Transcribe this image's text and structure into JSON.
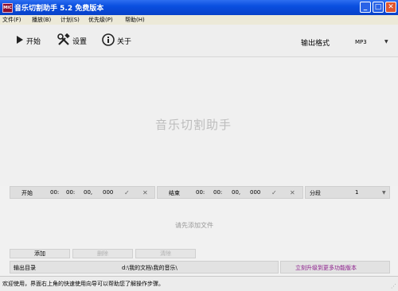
{
  "window": {
    "title": "音乐切割助手 5.2 免费版本",
    "icon_text": "MIC"
  },
  "menu": [
    "文件(F)",
    "播放(B)",
    "计划(S)",
    "优先级(P)",
    "帮助(H)"
  ],
  "toolbar": {
    "start": "开始",
    "settings": "设置",
    "about": "关于",
    "format_label": "输出格式",
    "format_value": "MP3"
  },
  "main": {
    "watermark": "音乐切割助手",
    "empty_hint": "请先添加文件"
  },
  "time": {
    "start_label": "开始",
    "start_h": "00:",
    "start_m": "00:",
    "start_s": "00,",
    "start_ms": "000",
    "end_label": "结束",
    "end_h": "00:",
    "end_m": "00:",
    "end_s": "00,",
    "end_ms": "000",
    "segment_label": "分段",
    "segment_value": "1"
  },
  "actions": {
    "add": "添加",
    "delete": "删除",
    "clear": "清除"
  },
  "output": {
    "label": "输出目录",
    "path": "d:\\我的文档\\我的音乐\\",
    "upgrade": "立刻升级到更多功能版本"
  },
  "status": "欢迎使用，界面右上角的快速使用向导可以帮助您了解操作步骤。",
  "colors": {
    "titlebar": "#0a4fe0",
    "upgrade_link": "#8b1a8b"
  }
}
